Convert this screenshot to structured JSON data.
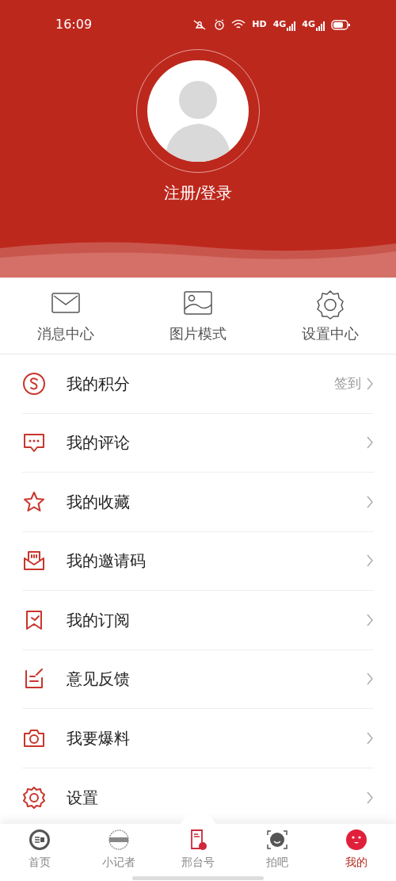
{
  "status_bar": {
    "time": "16:09",
    "network_labels": [
      "HD",
      "4G",
      "4G"
    ]
  },
  "profile": {
    "login_label": "注册/登录"
  },
  "quick_actions": [
    {
      "label": "消息中心"
    },
    {
      "label": "图片模式"
    },
    {
      "label": "设置中心"
    }
  ],
  "menu": [
    {
      "label": "我的积分",
      "trailing": "签到"
    },
    {
      "label": "我的评论"
    },
    {
      "label": "我的收藏"
    },
    {
      "label": "我的邀请码"
    },
    {
      "label": "我的订阅"
    },
    {
      "label": "意见反馈"
    },
    {
      "label": "我要爆料"
    },
    {
      "label": "设置"
    }
  ],
  "bottom_nav": [
    {
      "label": "首页",
      "selected": false
    },
    {
      "label": "小记者",
      "selected": false
    },
    {
      "label": "邢台号",
      "selected": false
    },
    {
      "label": "拍吧",
      "selected": false
    },
    {
      "label": "我的",
      "selected": true
    }
  ]
}
